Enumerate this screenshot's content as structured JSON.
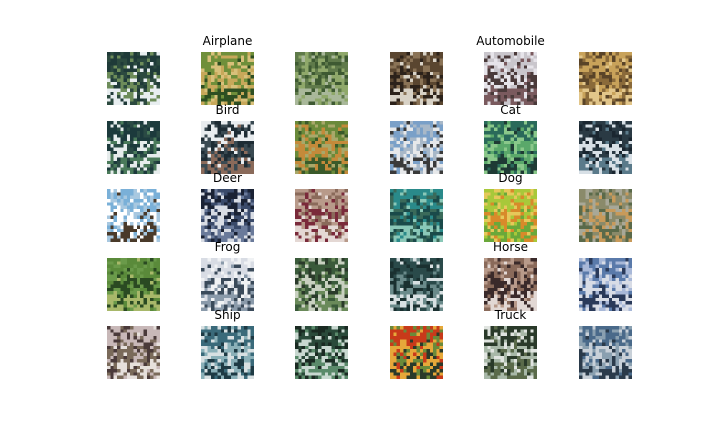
{
  "figure": {
    "classes": [
      {
        "name": "Airplane",
        "samples": [
          {
            "colors": [
              "#1f3a38",
              "#6d8c5a",
              "#e8eef0",
              "#2c4a3f"
            ]
          },
          {
            "colors": [
              "#6f8f3a",
              "#c7a85a",
              "#2e4f22",
              "#d8c07a"
            ]
          },
          {
            "colors": [
              "#5f7a4a",
              "#8fa86a",
              "#a9b89a",
              "#3e5a32"
            ]
          }
        ]
      },
      {
        "name": "Automobile",
        "samples": [
          {
            "colors": [
              "#5a4630",
              "#2c221a",
              "#d8d2c6",
              "#8a7356"
            ]
          },
          {
            "colors": [
              "#c9c6cc",
              "#4a3a3a",
              "#7a5a5e",
              "#e6e4ea"
            ]
          },
          {
            "colors": [
              "#c8a25a",
              "#8a6a3a",
              "#e2c68a",
              "#5a4428"
            ]
          }
        ]
      },
      {
        "name": "Bird",
        "samples": [
          {
            "colors": [
              "#1c3a3c",
              "#e6ecec",
              "#4a7a5a",
              "#2a4a44"
            ]
          },
          {
            "colors": [
              "#e8ecef",
              "#3a4a52",
              "#8a6a5a",
              "#1e2c34"
            ]
          },
          {
            "colors": [
              "#6a8a3a",
              "#c48a3a",
              "#3a5a2a",
              "#a8a86a"
            ]
          }
        ]
      },
      {
        "name": "Cat",
        "samples": [
          {
            "colors": [
              "#7aa0c8",
              "#e6e8ea",
              "#3a3a3a",
              "#a8b8c8"
            ]
          },
          {
            "colors": [
              "#2a6a5a",
              "#5aa86a",
              "#1e3a34",
              "#8ac88a"
            ]
          },
          {
            "colors": [
              "#2a3a44",
              "#d8e0e6",
              "#5a7a8a",
              "#1a2630"
            ]
          }
        ]
      },
      {
        "name": "Deer",
        "samples": [
          {
            "colors": [
              "#7ab0d8",
              "#ffffff",
              "#4a3a2a",
              "#a8c8e0"
            ]
          },
          {
            "colors": [
              "#1a2234",
              "#d8dce4",
              "#6a7a9a",
              "#3a4a6a"
            ]
          },
          {
            "colors": [
              "#b89a8a",
              "#7a2a3a",
              "#e4d8d4",
              "#8a6a5a"
            ]
          }
        ]
      },
      {
        "name": "Dog",
        "samples": [
          {
            "colors": [
              "#2a8a8a",
              "#1a4a4a",
              "#8ac8b8",
              "#3a6a5a"
            ]
          },
          {
            "colors": [
              "#a8c83a",
              "#d88a2a",
              "#6aa83a",
              "#e6c85a"
            ]
          },
          {
            "colors": [
              "#8a8a6a",
              "#c89a5a",
              "#5a6a4a",
              "#a8a898"
            ]
          }
        ]
      },
      {
        "name": "Frog",
        "samples": [
          {
            "colors": [
              "#5a8a3a",
              "#2a4a22",
              "#a8b86a",
              "#6a9a4a"
            ]
          },
          {
            "colors": [
              "#d8dce4",
              "#3a4a5a",
              "#8a9aaa",
              "#f0f2f4"
            ]
          },
          {
            "colors": [
              "#3a5a3a",
              "#c8d0c0",
              "#6a8a5a",
              "#2a3a2a"
            ]
          }
        ]
      },
      {
        "name": "Horse",
        "samples": [
          {
            "colors": [
              "#2a4a4a",
              "#6a8a8a",
              "#d8e0e2",
              "#1a3030"
            ]
          },
          {
            "colors": [
              "#8a6a5a",
              "#3a2a2a",
              "#e2d8d4",
              "#b89a8a"
            ]
          },
          {
            "colors": [
              "#5a7aaa",
              "#d8dce6",
              "#2a3a5a",
              "#a8b8d8"
            ]
          }
        ]
      },
      {
        "name": "Ship",
        "samples": [
          {
            "colors": [
              "#c8b8b8",
              "#7a6a5a",
              "#e6e0dc",
              "#4a3a3a"
            ]
          },
          {
            "colors": [
              "#3a6a7a",
              "#8ab0b8",
              "#1e3a44",
              "#d8e0e2"
            ]
          },
          {
            "colors": [
              "#2a4a3a",
              "#c8d8d0",
              "#5a8a6a",
              "#1a2a22"
            ]
          }
        ]
      },
      {
        "name": "Truck",
        "samples": [
          {
            "colors": [
              "#c83a1a",
              "#e6a83a",
              "#2a3a2a",
              "#6a8a3a"
            ]
          },
          {
            "colors": [
              "#2a3a2a",
              "#a8b8a8",
              "#5a6a4a",
              "#e0e4e0"
            ]
          },
          {
            "colors": [
              "#4a6a8a",
              "#c8d0d8",
              "#2a3a4a",
              "#8aa0b0"
            ]
          }
        ]
      }
    ]
  }
}
